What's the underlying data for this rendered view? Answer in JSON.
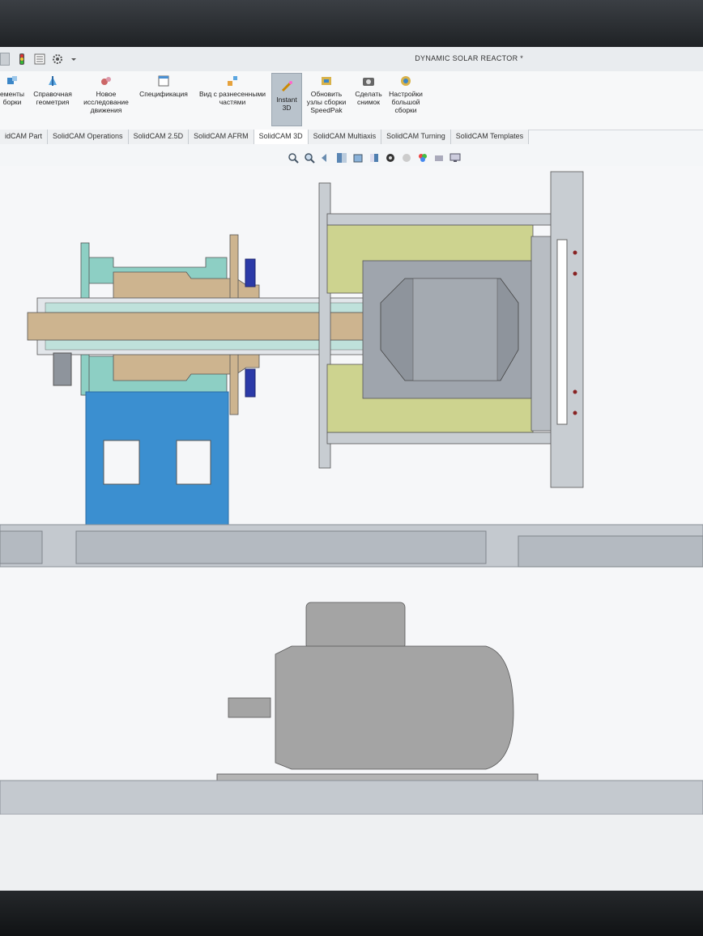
{
  "window": {
    "title": "DYNAMIC SOLAR REACTOR *"
  },
  "quick_access": [
    "file-icon",
    "traffic-light-icon",
    "list-icon",
    "gear-icon",
    "dropdown-arrow-icon"
  ],
  "ribbon": {
    "buttons": [
      {
        "id": "components",
        "label": "ементы\nборки",
        "icon": "components-icon"
      },
      {
        "id": "reference-geometry",
        "label": "Справочная\nгеометрия",
        "icon": "reference-geometry-icon"
      },
      {
        "id": "new-motion-study",
        "label": "Новое\nисследование\nдвижения",
        "icon": "motion-study-icon"
      },
      {
        "id": "bom",
        "label": "Спецификация",
        "icon": "bom-icon"
      },
      {
        "id": "exploded-view",
        "label": "Вид с разнесенными\nчастями",
        "icon": "exploded-view-icon"
      },
      {
        "id": "instant3d",
        "label": "Instant\n3D",
        "icon": "instant3d-icon",
        "active": true
      },
      {
        "id": "update-speedpak",
        "label": "Обновить\nузлы сборки\nSpeedPak",
        "icon": "speedpak-icon"
      },
      {
        "id": "snapshot",
        "label": "Сделать\nснимок",
        "icon": "camera-icon"
      },
      {
        "id": "large-assembly",
        "label": "Настройки\nбольшой\nсборки",
        "icon": "large-assembly-icon"
      }
    ]
  },
  "tabs": [
    {
      "label": "idCAM Part"
    },
    {
      "label": "SolidCAM Operations"
    },
    {
      "label": "SolidCAM 2.5D"
    },
    {
      "label": "SolidCAM AFRM"
    },
    {
      "label": "SolidCAM 3D",
      "active": true
    },
    {
      "label": "SolidCAM Multiaxis"
    },
    {
      "label": "SolidCAM Turning"
    },
    {
      "label": "SolidCAM Templates"
    }
  ],
  "view_toolbar": [
    "zoom-fit-icon",
    "zoom-area-icon",
    "previous-view-icon",
    "section-view-icon",
    "view-orientation-icon",
    "display-style-icon",
    "hide-show-icon",
    "edit-appearance-icon",
    "apply-scene-icon",
    "view-settings-icon",
    "monitor-icon"
  ],
  "colors": {
    "housing": "#c8cdd2",
    "shaft": "#cdb48f",
    "seal": "#8dcfc4",
    "base-blue": "#3b8fd0",
    "insulation": "#cdd38f",
    "steel": "#9fa5ad",
    "bolt": "#2b3aa8",
    "motor": "#a4a4a4"
  }
}
